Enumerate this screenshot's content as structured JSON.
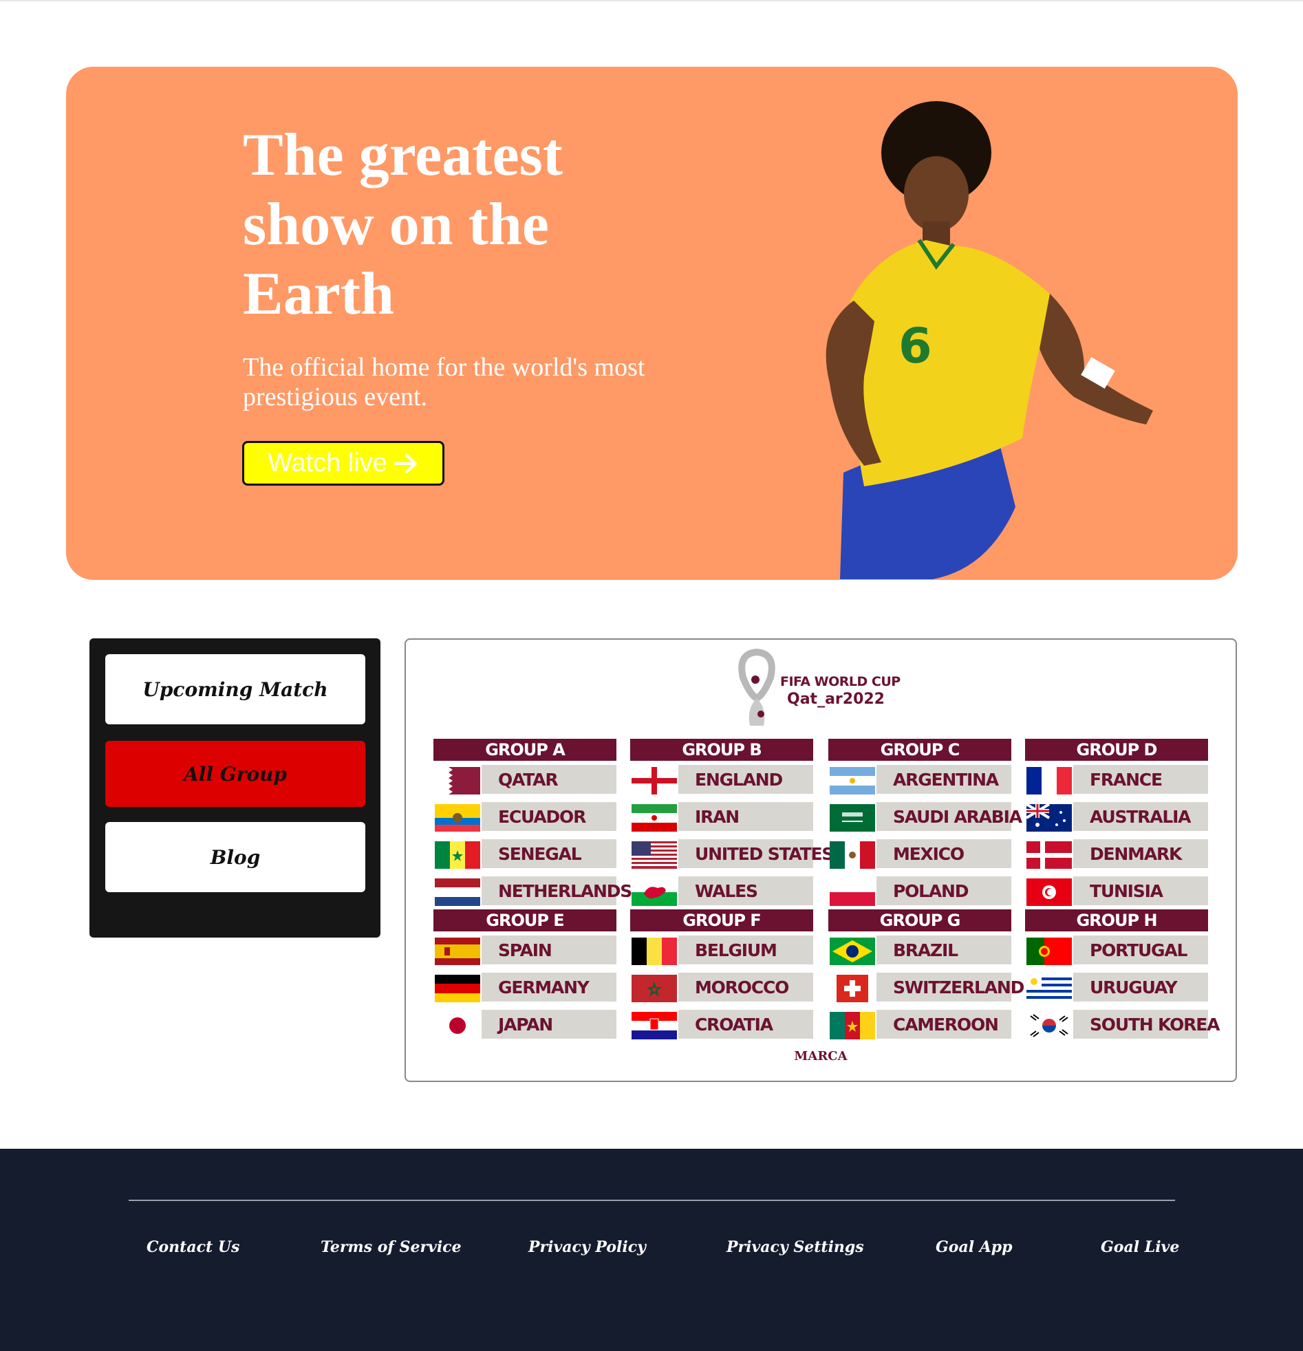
{
  "hero": {
    "title": "The greatest show on the Earth",
    "subtitle": "The official home for the world's most prestigious event.",
    "cta_label": "Watch live",
    "background_color": "#ff9966",
    "cta_color": "#ffff00"
  },
  "sidebar": {
    "items": [
      {
        "label": "Upcoming Match",
        "active": false
      },
      {
        "label": "All Group",
        "active": true
      },
      {
        "label": "Blog",
        "active": false
      }
    ]
  },
  "groups_panel": {
    "logo_line1": "FIFA WORLD CUP",
    "logo_line2": "Qat_ar2022",
    "credit": "MARCA",
    "groups": [
      {
        "name": "GROUP A",
        "teams": [
          "QATAR",
          "ECUADOR",
          "SENEGAL",
          "NETHERLANDS"
        ]
      },
      {
        "name": "GROUP B",
        "teams": [
          "ENGLAND",
          "IRAN",
          "UNITED STATES",
          "WALES"
        ]
      },
      {
        "name": "GROUP C",
        "teams": [
          "ARGENTINA",
          "SAUDI ARABIA",
          "MEXICO",
          "POLAND"
        ]
      },
      {
        "name": "GROUP D",
        "teams": [
          "FRANCE",
          "AUSTRALIA",
          "DENMARK",
          "TUNISIA"
        ]
      },
      {
        "name": "GROUP E",
        "teams": [
          "SPAIN",
          "GERMANY",
          "JAPAN"
        ]
      },
      {
        "name": "GROUP F",
        "teams": [
          "BELGIUM",
          "MOROCCO",
          "CROATIA"
        ]
      },
      {
        "name": "GROUP G",
        "teams": [
          "BRAZIL",
          "SWITZERLAND",
          "CAMEROON"
        ]
      },
      {
        "name": "GROUP H",
        "teams": [
          "PORTUGAL",
          "URUGUAY",
          "SOUTH KOREA"
        ]
      }
    ]
  },
  "footer": {
    "links": [
      "Contact Us",
      "Terms of Service",
      "Privacy Policy",
      "Privacy Settings",
      "Goal App",
      "Goal Live"
    ]
  }
}
